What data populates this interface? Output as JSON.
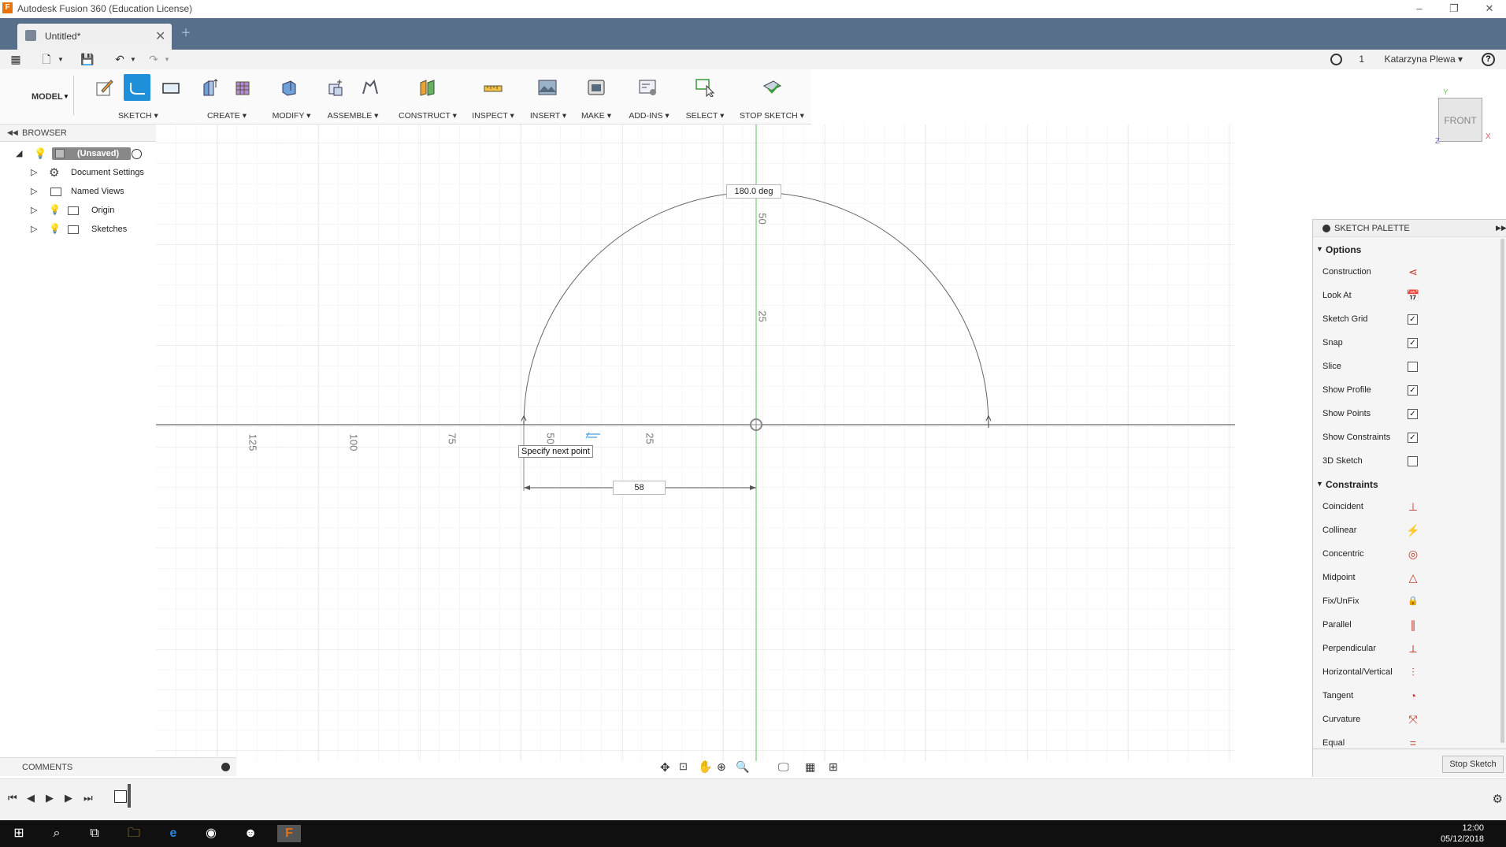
{
  "window": {
    "title": "Autodesk Fusion 360 (Education License)",
    "minimize": "–",
    "restore": "❐",
    "close": "✕"
  },
  "document_tab": {
    "label": "Untitled*",
    "close": "✕",
    "new_tab": "+"
  },
  "quick_access": {
    "jobs_count": "1",
    "user_name": "Katarzyna Plewa ▾",
    "help": "?"
  },
  "ribbon": {
    "workspace": "MODEL",
    "groups": [
      {
        "label": "SKETCH ▾"
      },
      {
        "label": "CREATE ▾"
      },
      {
        "label": "MODIFY ▾"
      },
      {
        "label": "ASSEMBLE ▾"
      },
      {
        "label": "CONSTRUCT ▾"
      },
      {
        "label": "INSPECT ▾"
      },
      {
        "label": "INSERT ▾"
      },
      {
        "label": "MAKE ▾"
      },
      {
        "label": "ADD-INS ▾"
      },
      {
        "label": "SELECT ▾"
      },
      {
        "label": "STOP SKETCH ▾"
      }
    ]
  },
  "browser": {
    "title": "BROWSER",
    "items": [
      {
        "label": "(Unsaved)"
      },
      {
        "label": "Document Settings"
      },
      {
        "label": "Named Views"
      },
      {
        "label": "Origin"
      },
      {
        "label": "Sketches"
      }
    ]
  },
  "canvas": {
    "angle_input": "180.0 deg",
    "dimension_input": "58",
    "tooltip": "Specify next point",
    "x_ticks": [
      "125",
      "100",
      "75",
      "50",
      "25"
    ],
    "y_ticks": [
      "50",
      "25"
    ],
    "viewcube_label": "FRONT",
    "axis_x": "X",
    "axis_y": "Y",
    "axis_z": "Z"
  },
  "sketch_palette": {
    "title": "SKETCH PALETTE",
    "options_title": "Options",
    "options": [
      {
        "label": "Construction",
        "type": "icon",
        "icon": "construction-icon"
      },
      {
        "label": "Look At",
        "type": "icon",
        "icon": "look-at-icon"
      },
      {
        "label": "Sketch Grid",
        "type": "check",
        "checked": true
      },
      {
        "label": "Snap",
        "type": "check",
        "checked": true
      },
      {
        "label": "Slice",
        "type": "check",
        "checked": false
      },
      {
        "label": "Show Profile",
        "type": "check",
        "checked": true
      },
      {
        "label": "Show Points",
        "type": "check",
        "checked": true
      },
      {
        "label": "Show Constraints",
        "type": "check",
        "checked": true
      },
      {
        "label": "3D Sketch",
        "type": "check",
        "checked": false
      }
    ],
    "constraints_title": "Constraints",
    "constraints": [
      {
        "label": "Coincident",
        "glyph": "⊥"
      },
      {
        "label": "Collinear",
        "glyph": "⚡"
      },
      {
        "label": "Concentric",
        "glyph": "◎"
      },
      {
        "label": "Midpoint",
        "glyph": "△"
      },
      {
        "label": "Fix/UnFix",
        "glyph": "🔒"
      },
      {
        "label": "Parallel",
        "glyph": "∥"
      },
      {
        "label": "Perpendicular",
        "glyph": "⟂"
      },
      {
        "label": "Horizontal/Vertical",
        "glyph": "⫶"
      },
      {
        "label": "Tangent",
        "glyph": "◔"
      },
      {
        "label": "Curvature",
        "glyph": "⤧"
      },
      {
        "label": "Equal",
        "glyph": "="
      }
    ],
    "stop_button": "Stop Sketch"
  },
  "comments": {
    "title": "COMMENTS"
  },
  "taskbar": {
    "time": "12:00",
    "date": "05/12/2018"
  },
  "colors": {
    "accent": "#1e8fd8",
    "tabbar": "#576f8a",
    "y_axis": "#7ed37e",
    "constraint_icon": "#c0392b"
  }
}
